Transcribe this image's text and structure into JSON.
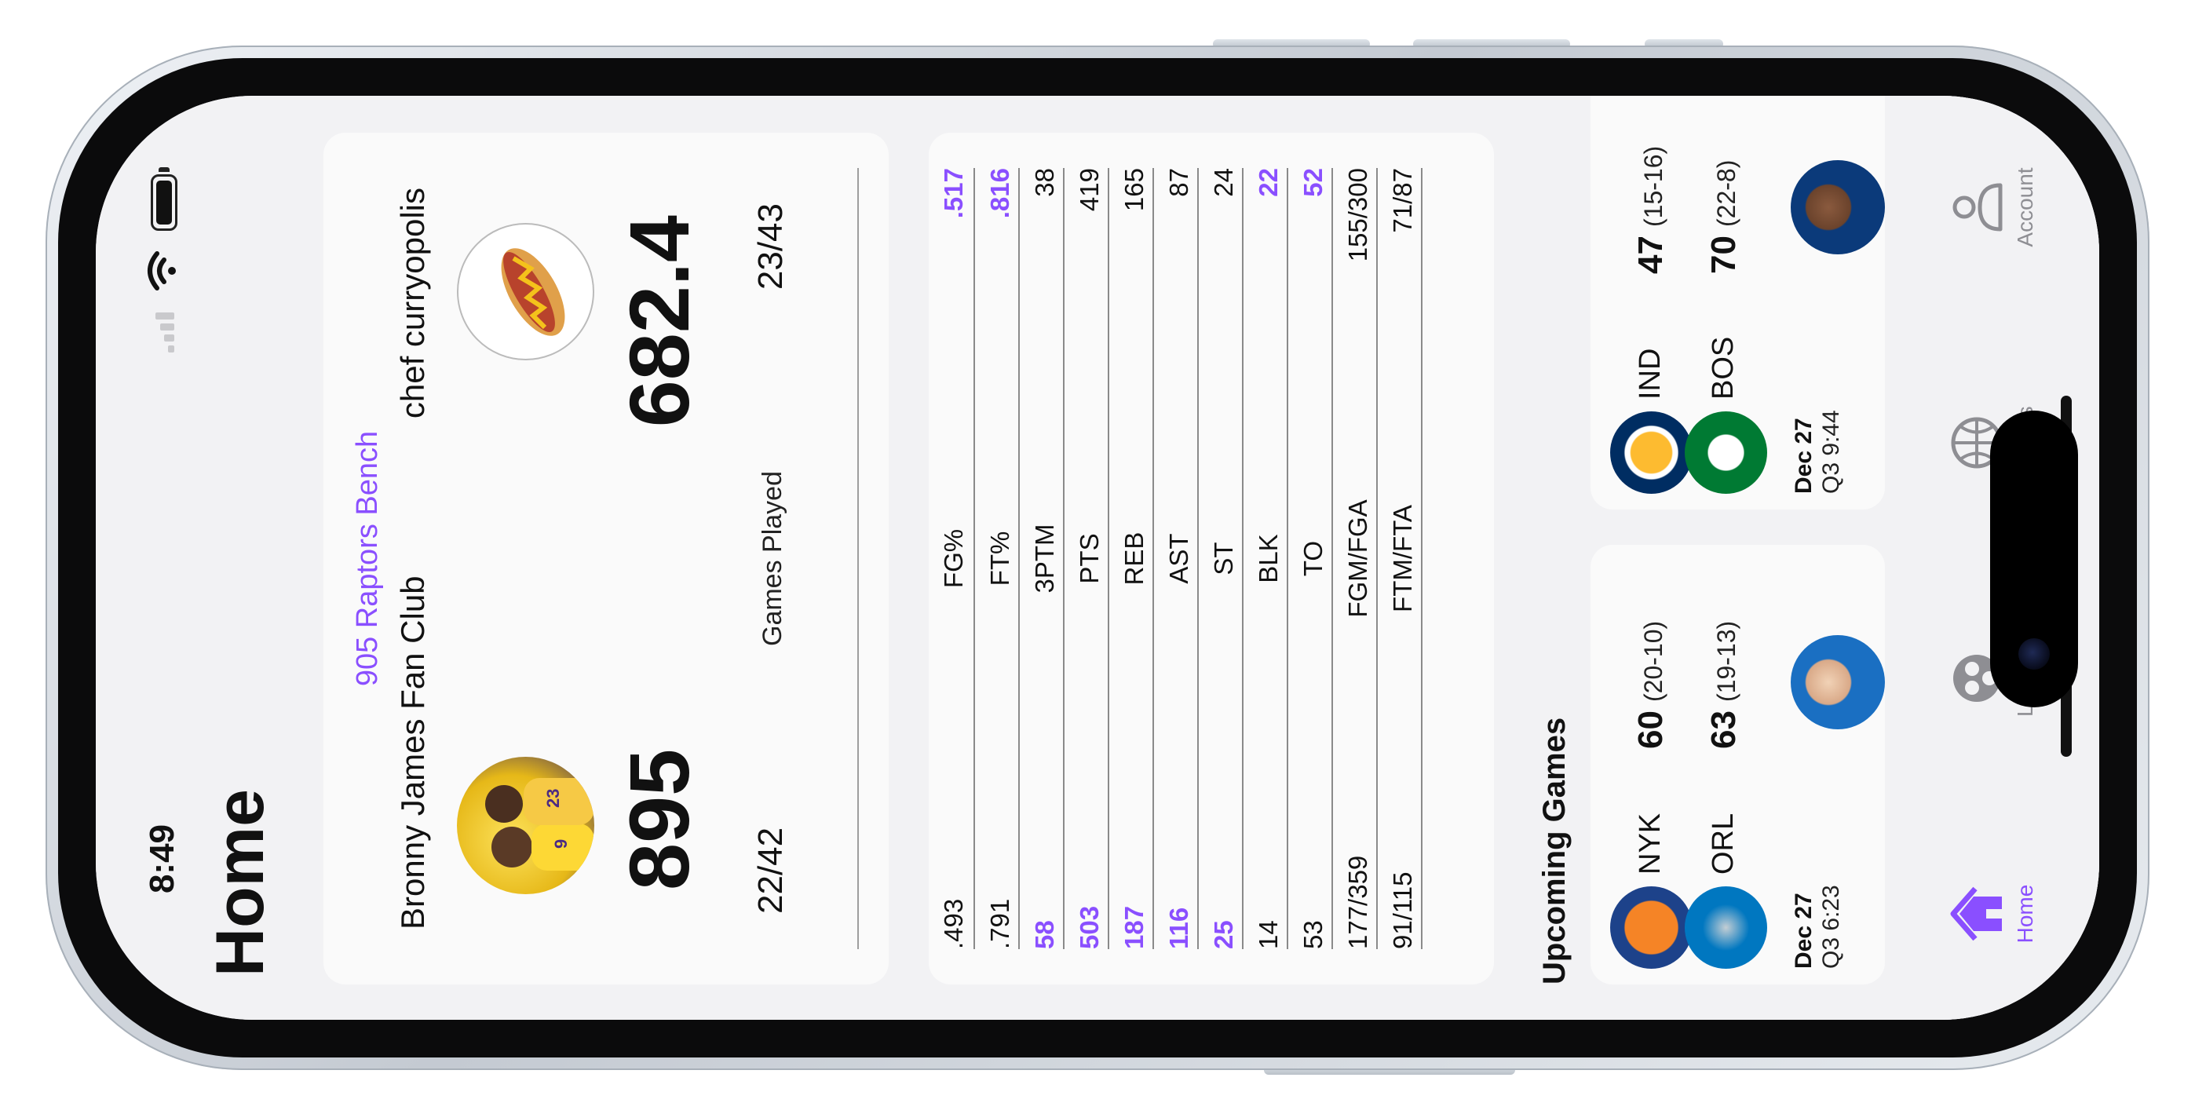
{
  "status_bar": {
    "time": "8:49"
  },
  "header": {
    "title": "Home"
  },
  "matchup": {
    "league": "905 Raptors Bench",
    "home": {
      "team": "Bronny James Fan Club",
      "score": "895",
      "games_played": "22/42"
    },
    "away": {
      "team": "chef curryopolis",
      "score": "682.4",
      "games_played": "23/43"
    },
    "games_played_label": "Games Played"
  },
  "stats": [
    {
      "label": "FG%",
      "home": ".493",
      "away": ".517",
      "winner": "away"
    },
    {
      "label": "FT%",
      "home": ".791",
      "away": ".816",
      "winner": "away"
    },
    {
      "label": "3PTM",
      "home": "58",
      "away": "38",
      "winner": "home"
    },
    {
      "label": "PTS",
      "home": "503",
      "away": "419",
      "winner": "home"
    },
    {
      "label": "REB",
      "home": "187",
      "away": "165",
      "winner": "home"
    },
    {
      "label": "AST",
      "home": "116",
      "away": "87",
      "winner": "home"
    },
    {
      "label": "ST",
      "home": "25",
      "away": "24",
      "winner": "home"
    },
    {
      "label": "BLK",
      "home": "14",
      "away": "22",
      "winner": "away"
    },
    {
      "label": "TO",
      "home": "53",
      "away": "52",
      "winner": "away"
    },
    {
      "label": "FGM/FGA",
      "home": "177/359",
      "away": "155/300",
      "winner": "none"
    },
    {
      "label": "FTM/FTA",
      "home": "91/115",
      "away": "71/87",
      "winner": "none"
    }
  ],
  "upcoming": {
    "title": "Upcoming Games",
    "games": [
      {
        "team1": "NYK",
        "team2": "ORL",
        "score1": "60",
        "score2": "63",
        "record1": "(20-10)",
        "record2": "(19-13)",
        "date": "Dec 27",
        "clock": "Q3 6:23"
      },
      {
        "team1": "IND",
        "team2": "BOS",
        "score1": "47",
        "score2": "70",
        "record1": "(15-16)",
        "record2": "(22-8)",
        "date": "Dec 27",
        "clock": "Q3 9:44"
      }
    ]
  },
  "tabs": [
    {
      "label": "Home",
      "icon": "home-icon",
      "active": true
    },
    {
      "label": "Lineups",
      "icon": "lineups-icon",
      "active": false
    },
    {
      "label": "Players",
      "icon": "basketball-icon",
      "active": false
    },
    {
      "label": "Account",
      "icon": "person-icon",
      "active": false
    }
  ],
  "colors": {
    "accent": "#8a4fff",
    "background": "#f2f2f4",
    "card": "#fafafa"
  }
}
